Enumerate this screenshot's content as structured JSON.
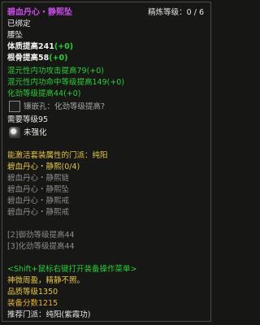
{
  "item": {
    "name": "碧血丹心・静熙坠",
    "refine_label": "精炼等级：0 / 6",
    "bind_state": "已绑定",
    "slot": "腰坠",
    "base_attrs": [
      {
        "text": "体质提高241",
        "bonus": "(+0)"
      },
      {
        "text": "根骨提高58",
        "bonus": "(+0)"
      }
    ],
    "magic_attrs": [
      {
        "text": "混元性内功攻击提高79",
        "bonus": "(+0)"
      },
      {
        "text": "混元性内功命中等级提高149",
        "bonus": "(+0)"
      },
      {
        "text": "化劲等级提高44",
        "bonus": "(+0)"
      }
    ],
    "socket_text": "镶嵌孔：化劲等级提高?",
    "require_level": "需要等级95",
    "enhance_state": "未强化",
    "set": {
      "header": "能激活套装属性的门派：纯阳",
      "name": "碧血丹心・静熙(0/4)",
      "pieces": [
        "碧血丹心・静熙链",
        "碧血丹心・静熙坠",
        "碧血丹心・静熙戒",
        "碧血丹心・静熙戒"
      ],
      "bonuses": [
        "[2]御劲等级提高44",
        "[3]化劲等级提高44"
      ]
    },
    "shift_hint": "<Shift+鼠标右键打开装备操作菜单>",
    "flavor": "神微周盈，精静不照。",
    "quality_level": "品质等级1350",
    "score": "装备分数1215",
    "recommend": "推荐门派：纯阳(紫霞功)"
  },
  "colors": {
    "title": "#c84ce6",
    "green": "#2ecc3a",
    "yellow": "#e6c64a",
    "orange": "#e8b03a"
  },
  "icons": {
    "socket": "empty-socket-icon",
    "enhance": "enhance-stone-icon"
  }
}
